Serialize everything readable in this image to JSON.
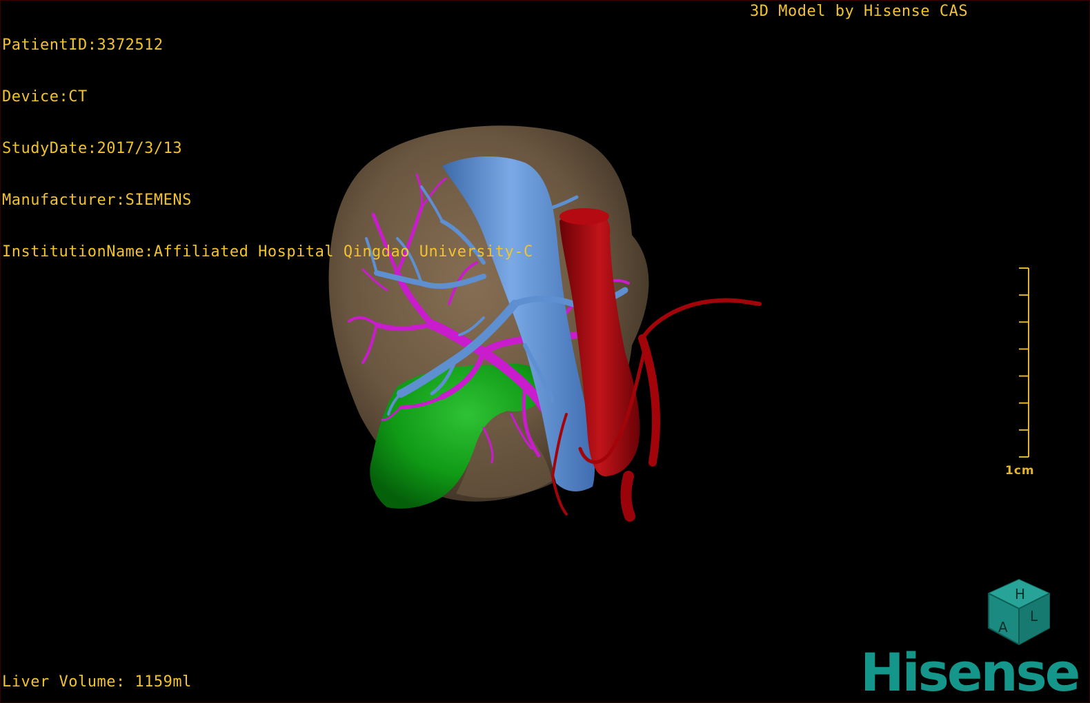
{
  "colors": {
    "overlay_text": "#f2c230",
    "scale_bar": "#e3b52b",
    "liver": "#8a7256",
    "portal_vein": "#5e8fd0",
    "hepatic_vessels": "#c81ccd",
    "aorta": "#a3040a",
    "gallbladder": "#0f8f15",
    "brand": "#14968a",
    "cube": "#1b8a80"
  },
  "dicom": {
    "patient_id": "PatientID:3372512",
    "device": "Device:CT",
    "study_date": "StudyDate:2017/3/13",
    "manufacturer": "Manufacturer:SIEMENS",
    "institution": "InstitutionName:Affiliated Hospital Qingdao University-C"
  },
  "model_credit": "3D Model by Hisense CAS",
  "liver_volume": "Liver Volume: 1159ml",
  "scale_bar": {
    "label": "1cm"
  },
  "orientation_cube": {
    "face_top": "H",
    "face_front": "A",
    "face_side": "L"
  },
  "brand": "Hisense",
  "structures": [
    "liver",
    "portal-vein",
    "hepatic-veins",
    "aorta",
    "hepatic-artery",
    "gallbladder"
  ]
}
